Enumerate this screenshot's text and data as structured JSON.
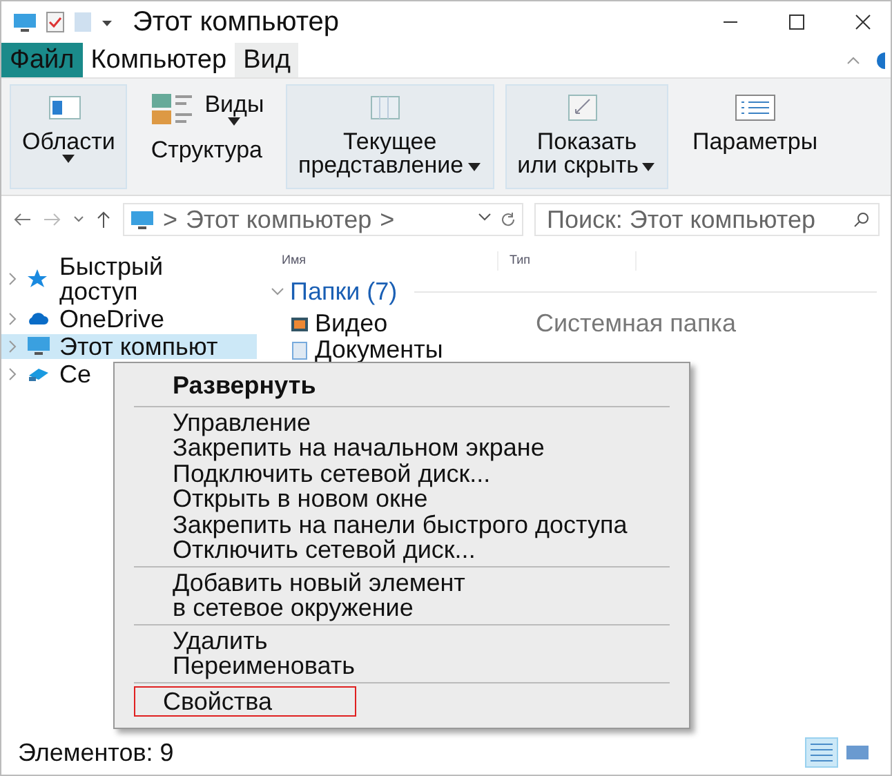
{
  "window": {
    "title": "Этот компьютер"
  },
  "menu_tabs": [
    {
      "label": "Файл",
      "kind": "file",
      "selected": false
    },
    {
      "label": "Компьютер",
      "kind": "tab",
      "selected": false
    },
    {
      "label": "Вид",
      "kind": "tab",
      "selected": true
    }
  ],
  "ribbon": [
    {
      "kind": "large",
      "label": "Области",
      "dropdown": true
    },
    {
      "kind": "stack",
      "top": "Виды",
      "top_dropdown": true,
      "bottom": "Структура"
    },
    {
      "kind": "large",
      "label": "Текущее\nпредставление",
      "dropdown": true
    },
    {
      "kind": "large",
      "label": "Показать\nили скрыть",
      "dropdown": true
    },
    {
      "kind": "large",
      "label": "Параметры",
      "dropdown": false
    }
  ],
  "address": {
    "breadcrumb": [
      ">",
      "Этот компьютер",
      ">"
    ],
    "placeholder": "Поиск: Этот компьютер"
  },
  "nav": [
    {
      "label": "Быстрый\nдоступ",
      "selected": false
    },
    {
      "label": "OneDrive",
      "selected": false
    },
    {
      "label": "Этот компьют",
      "selected": true
    },
    {
      "label": "Се",
      "selected": false
    }
  ],
  "columns": [
    "Имя",
    "Тип"
  ],
  "group": {
    "label": "Папки (7)",
    "expanded": true
  },
  "rows": [
    {
      "name": "Видео",
      "type": "Системная папка"
    },
    {
      "name": "Документы"
    }
  ],
  "context_menu": [
    [
      {
        "label": "Развернуть",
        "default": true,
        "highlighted": false
      }
    ],
    [
      {
        "label": "Управление",
        "default": false,
        "highlighted": false
      },
      {
        "label": "Закрепить на начальном экране",
        "default": false,
        "highlighted": false
      },
      {
        "label": "Подключить сетевой диск...",
        "default": false,
        "highlighted": false
      },
      {
        "label": "Открыть в новом окне",
        "default": false,
        "highlighted": false
      },
      {
        "label": "Закрепить на панели быстрого доступа",
        "default": false,
        "highlighted": false
      },
      {
        "label": "Отключить сетевой диск...",
        "default": false,
        "highlighted": false
      }
    ],
    [
      {
        "label": "Добавить новый элемент\nв сетевое окружение",
        "default": false,
        "highlighted": false
      }
    ],
    [
      {
        "label": "Удалить",
        "default": false,
        "highlighted": false
      },
      {
        "label": "Переименовать",
        "default": false,
        "highlighted": false
      }
    ],
    [
      {
        "label": "Свойства",
        "default": false,
        "highlighted": true
      }
    ]
  ],
  "status_bar": {
    "text": "Элементов: 9",
    "views": [
      {
        "kind": "details",
        "selected": true
      },
      {
        "kind": "tiles",
        "selected": false
      }
    ]
  }
}
